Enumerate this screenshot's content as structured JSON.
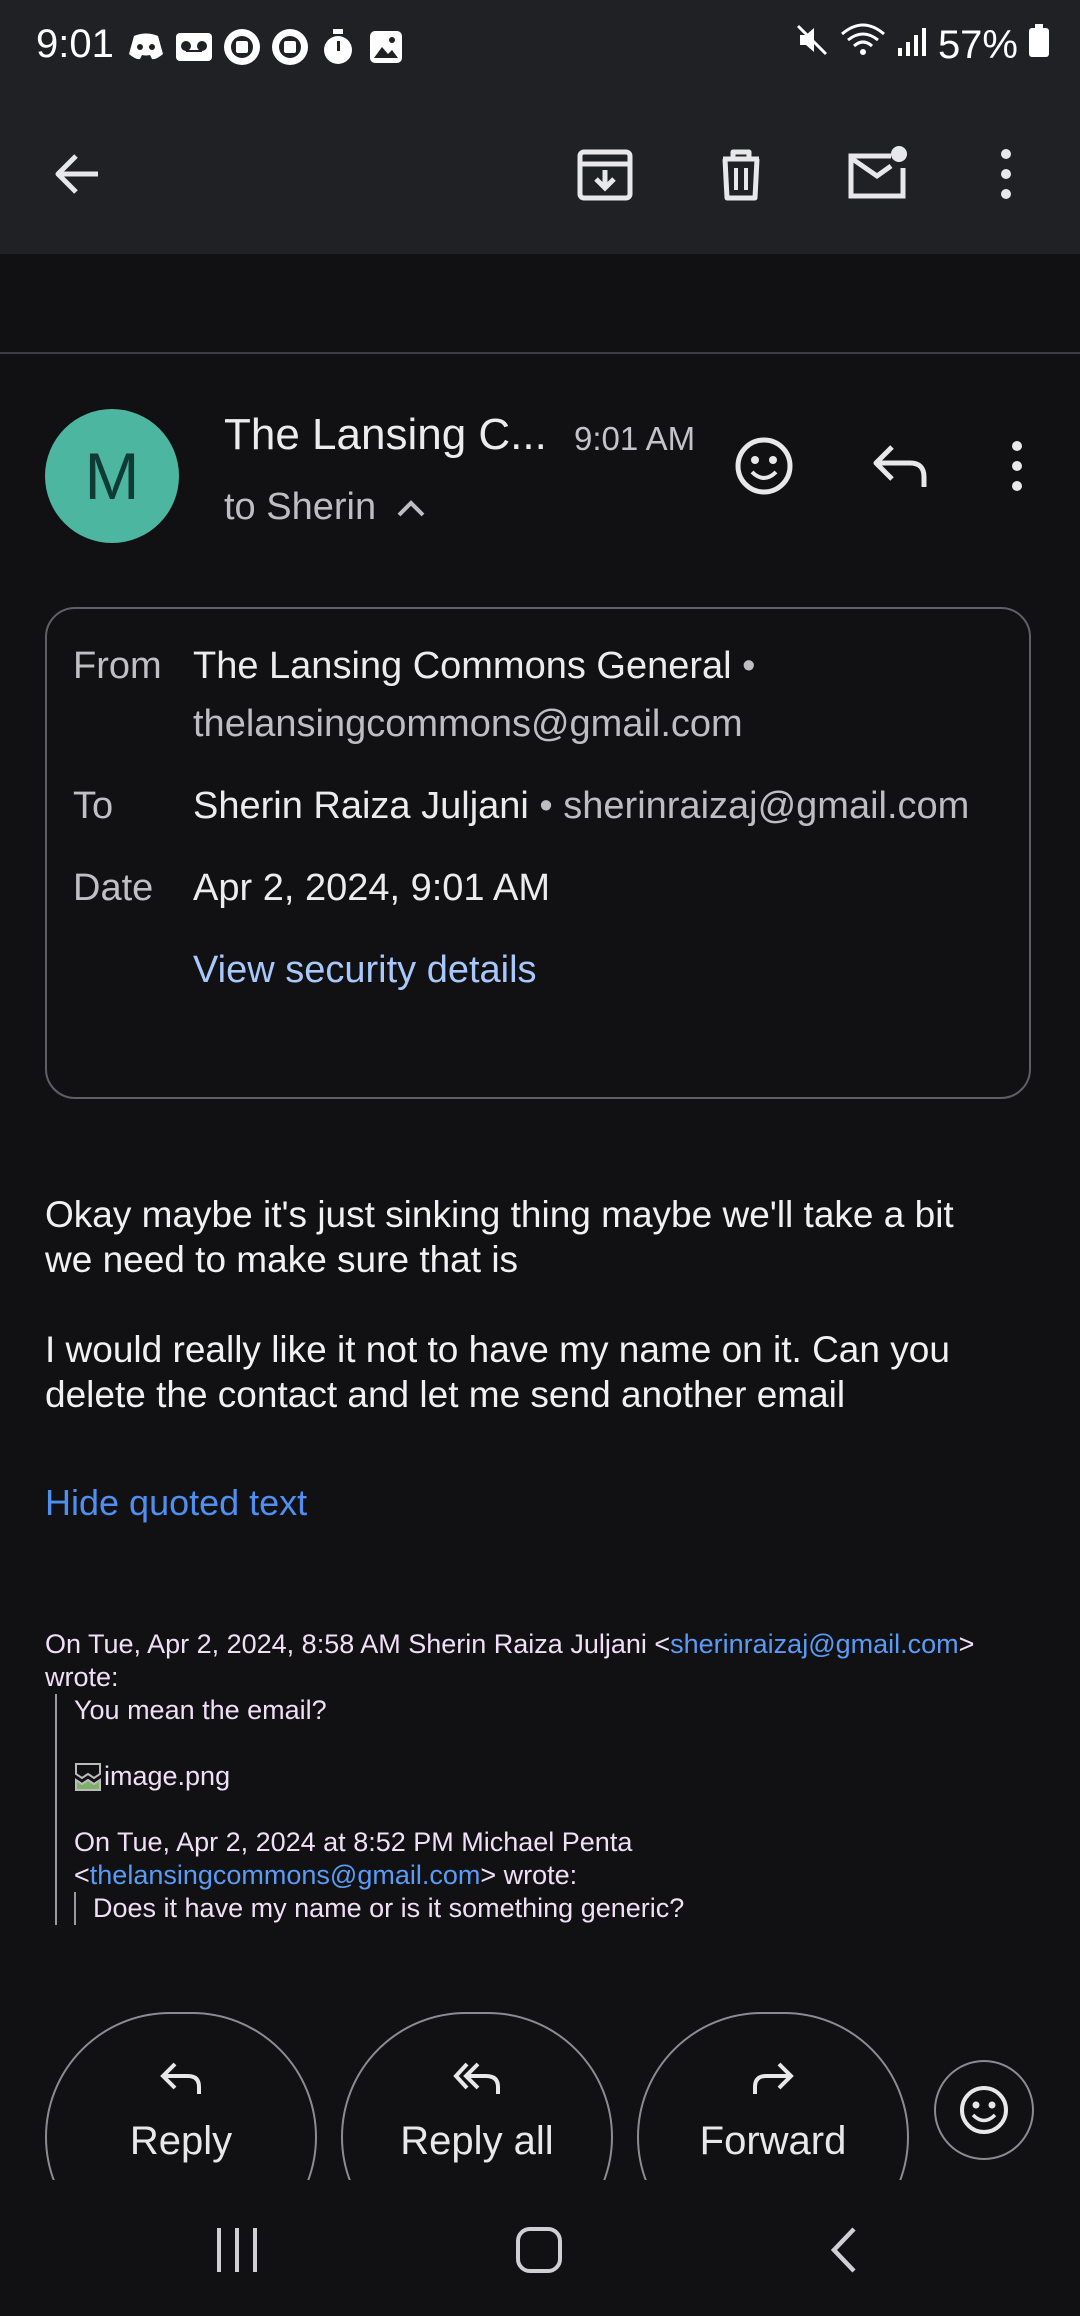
{
  "status_bar": {
    "time": "9:01",
    "battery": "57%"
  },
  "toolbar": {
    "back_icon": "arrow-left-icon",
    "archive_icon": "archive-icon",
    "delete_icon": "trash-icon",
    "mark_unread_icon": "mail-unread-icon",
    "more_icon": "more-vert-icon"
  },
  "header": {
    "avatar_letter": "M",
    "avatar_color": "#4db6a1",
    "sender": "The Lansing C...",
    "time": "9:01 AM",
    "to_line": "to Sherin"
  },
  "details": {
    "from_label": "From",
    "from_name": "The Lansing Commons General",
    "from_email": "thelansingcommons@gmail.com",
    "to_label": "To",
    "to_name": "Sherin Raiza Juljani",
    "to_email": "sherinraizaj@gmail.com",
    "date_label": "Date",
    "date_value": "Apr 2, 2024, 9:01 AM",
    "security_link": "View security details",
    "separator": "•"
  },
  "body": {
    "para1_line1": "Okay maybe it's just sinking thing maybe we'll take a bit",
    "para1_line2": "we need to make sure that is",
    "para2_line1": "I would really like it not to have my name on it. Can you",
    "para2_line2": "delete the contact and let me send another email"
  },
  "hide_quoted": "Hide quoted text",
  "quoted": {
    "attrib1_prefix": "On Tue, Apr 2, 2024, 8:58 AM Sherin Raiza Juljani <",
    "attrib1_email": "sherinraizaj@gmail.com",
    "attrib1_suffix": ">",
    "attrib1_line2": "wrote:",
    "msg1": "You mean the email?",
    "image_alt": "image.png",
    "attrib2_line1": "On Tue, Apr 2, 2024 at 8:52 PM Michael Penta",
    "attrib2_open": "<",
    "attrib2_email": "thelansingcommons@gmail.com",
    "attrib2_suffix": "> wrote:",
    "msg2": "Does it have my name or is it something generic?"
  },
  "actions": {
    "reply": "Reply",
    "reply_all": "Reply all",
    "forward": "Forward"
  },
  "colors": {
    "link": "#a8c7fa",
    "hide_quoted": "#4f8ff0",
    "quoted_text": "#f1def7",
    "quoted_link": "#5a9bf5"
  }
}
